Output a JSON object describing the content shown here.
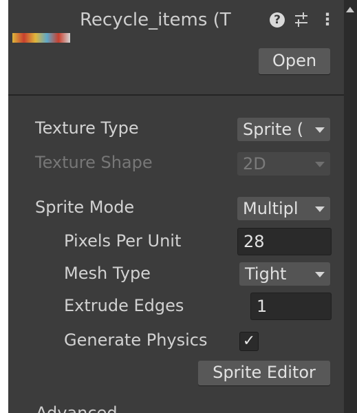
{
  "header": {
    "title": "Recycle_items (T",
    "help_glyph": "?",
    "kebab_glyph": "⋮",
    "open_label": "Open"
  },
  "settings": {
    "texture_type_label": "Texture Type",
    "texture_type_value": "Sprite (",
    "texture_shape_label": "Texture Shape",
    "texture_shape_value": "2D",
    "sprite_mode_label": "Sprite Mode",
    "sprite_mode_value": "Multipl",
    "pixels_per_unit_label": "Pixels Per Unit",
    "pixels_per_unit_value": "28",
    "mesh_type_label": "Mesh Type",
    "mesh_type_value": "Tight",
    "extrude_edges_label": "Extrude Edges",
    "extrude_edges_value": "1",
    "generate_physics_label": "Generate Physics",
    "generate_physics_checked": true,
    "checkmark_glyph": "✓",
    "sprite_editor_label": "Sprite Editor"
  },
  "footer": {
    "partial_label": "Advanced"
  },
  "colors": {
    "panel_bg": "#3c3c3c",
    "button_bg": "#585858",
    "field_bg": "#2a2a2a",
    "text": "#d2d2d2",
    "disabled_text": "#777777"
  }
}
